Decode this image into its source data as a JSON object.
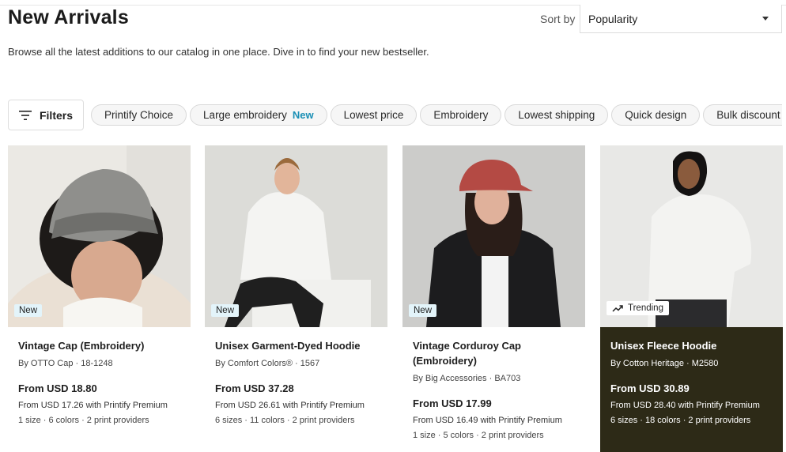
{
  "header": {
    "title": "New Arrivals",
    "subtitle": "Browse all the latest additions to our catalog in one place. Dive in to find your new bestseller.",
    "sort_label": "Sort by",
    "sort_value": "Popularity"
  },
  "filters": {
    "button_label": "Filters",
    "chips": [
      {
        "label": "Printify Choice"
      },
      {
        "label": "Large embroidery",
        "tag": "New"
      },
      {
        "label": "Lowest price"
      },
      {
        "label": "Embroidery"
      },
      {
        "label": "Lowest shipping"
      },
      {
        "label": "Quick design"
      },
      {
        "label": "Bulk discount"
      }
    ]
  },
  "products": [
    {
      "name": "Vintage Cap (Embroidery)",
      "brand": "By OTTO Cap · 18-1248",
      "price": "From USD 18.80",
      "premium": "From USD 17.26 with Printify Premium",
      "meta": "1 size · 6 colors · 2 print providers",
      "badge": "New"
    },
    {
      "name": "Unisex Garment-Dyed Hoodie",
      "brand": "By Comfort Colors® · 1567",
      "price": "From USD 37.28",
      "premium": "From USD 26.61 with Printify Premium",
      "meta": "6 sizes · 11 colors · 2 print providers",
      "badge": "New"
    },
    {
      "name": "Vintage Corduroy Cap (Embroidery)",
      "brand": "By Big Accessories · BA703",
      "price": "From USD 17.99",
      "premium": "From USD 16.49 with Printify Premium",
      "meta": "1 size · 5 colors · 2 print providers",
      "badge": "New"
    },
    {
      "name": "Unisex Fleece Hoodie",
      "brand": "By Cotton Heritage · M2580",
      "price": "From USD 30.89",
      "premium": "From USD 28.40 with Printify Premium",
      "meta": "6 sizes · 18 colors · 2 print providers",
      "badge": "Trending"
    }
  ],
  "colors": {
    "new_tag": "#1a8fb5",
    "badge_bg": "#e3f4fa",
    "featured_card_bg": "#2d2a17"
  },
  "icons": {
    "filters": "filter-lines-icon",
    "sort": "chevron-down-icon",
    "trending": "trending-up-icon"
  }
}
